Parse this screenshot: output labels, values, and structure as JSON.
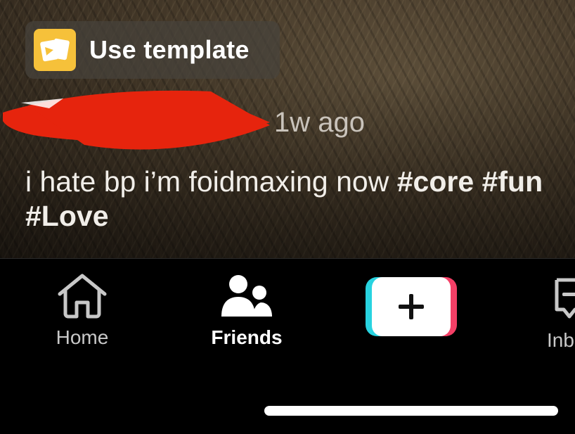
{
  "template_button": {
    "label": "Use template",
    "icon": "template-icon"
  },
  "post": {
    "time_ago": "1w ago",
    "caption_text": "i hate bp i’m foidmaxing now",
    "hashtags": [
      "#core",
      "#fun",
      "#Love"
    ]
  },
  "tabs": [
    {
      "label": "Home",
      "icon": "home-icon",
      "active": false
    },
    {
      "label": "Friends",
      "icon": "friends-icon",
      "active": true
    },
    {
      "label": "",
      "icon": "create-plus-icon",
      "active": false
    },
    {
      "label": "Inb",
      "icon": "inbox-icon",
      "active": false
    }
  ],
  "colors": {
    "template_icon_bg": "#f6c13a",
    "redaction": "#e6240d",
    "create_cyan": "#28d3e0",
    "create_pink": "#f43f66"
  }
}
